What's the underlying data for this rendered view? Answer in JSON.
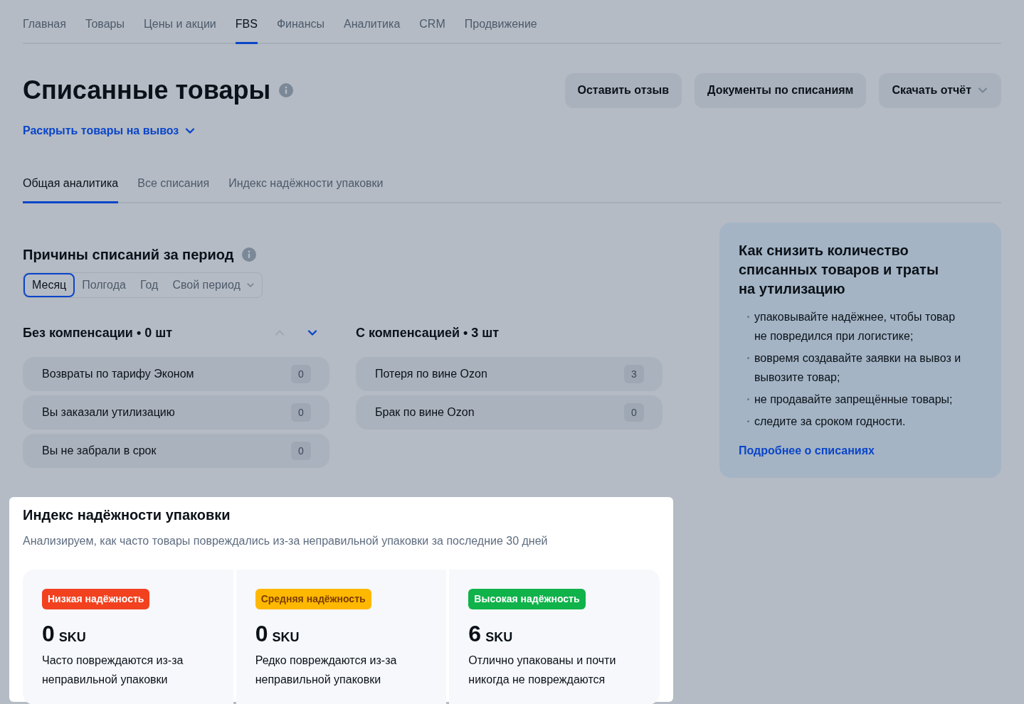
{
  "nav": [
    {
      "label": "Главная",
      "selected": false
    },
    {
      "label": "Товары",
      "selected": false
    },
    {
      "label": "Цены и акции",
      "selected": false
    },
    {
      "label": "FBS",
      "selected": true
    },
    {
      "label": "Финансы",
      "selected": false
    },
    {
      "label": "Аналитика",
      "selected": false
    },
    {
      "label": "CRM",
      "selected": false
    },
    {
      "label": "Продвижение",
      "selected": false
    }
  ],
  "page_title": "Списанные товары",
  "actions": [
    {
      "label": "Оставить отзыв",
      "kind": "plain"
    },
    {
      "label": "Документы по списаниям",
      "kind": "plain"
    },
    {
      "label": "Скачать отчёт",
      "kind": "dropdown"
    }
  ],
  "expand_link": "Раскрыть товары на вывоз",
  "tabs": [
    {
      "label": "Общая аналитика",
      "selected": true
    },
    {
      "label": "Все списания",
      "selected": false
    },
    {
      "label": "Индекс надёжности упаковки",
      "selected": false
    }
  ],
  "reasons": {
    "title": "Причины списаний за период",
    "periods": [
      {
        "label": "Месяц",
        "selected": true,
        "kind": "option"
      },
      {
        "label": "Полгода",
        "selected": false,
        "kind": "option"
      },
      {
        "label": "Год",
        "selected": false,
        "kind": "option"
      },
      {
        "label": "Свой период",
        "selected": false,
        "kind": "dropdown"
      }
    ],
    "groups": [
      {
        "title": "Без компенсации • 0 шт",
        "arrows": [
          {
            "kind": "up",
            "disabled": true
          },
          {
            "kind": "down",
            "disabled": false
          }
        ],
        "items": [
          {
            "label": "Возвраты по тарифу Эконом",
            "count": "0"
          },
          {
            "label": "Вы заказали утилизацию",
            "count": "0"
          },
          {
            "label": "Вы не забрали в срок",
            "count": "0"
          }
        ]
      },
      {
        "title": "С компенсацией • 3 шт",
        "items": [
          {
            "label": "Потеря по вине Ozon",
            "count": "3"
          },
          {
            "label": "Брак по вине Ozon",
            "count": "0"
          }
        ]
      }
    ]
  },
  "tips": {
    "title": "Как снизить количество списанных товаров и траты на утилизацию",
    "items": [
      "упаковывайте надёжнее, чтобы товар не повредился при логистике;",
      "вовремя создавайте заявки на вывоз и вывозите товар;",
      "не продавайте запрещённые товары;",
      "следите за сроком годности."
    ],
    "link": "Подробнее о списаниях"
  },
  "reliability": {
    "title": "Индекс надёжности упаковки",
    "subtitle": "Анализируем, как часто товары повреждались из-за неправильной упаковки за последние 30 дней",
    "levels": [
      {
        "badge": "Низкая надёжность",
        "color": "#f2411f",
        "kind": "low",
        "count": "0",
        "unit": "SKU",
        "description": "Часто повреждаются из-за неправильной упаковки"
      },
      {
        "badge": "Средняя надёжность",
        "color": "#ffb800",
        "kind": "medium",
        "count": "0",
        "unit": "SKU",
        "description": "Редко повреждаются из-за неправильной упаковки"
      },
      {
        "badge": "Высокая надёжность",
        "color": "#10b24a",
        "kind": "high",
        "count": "6",
        "unit": "SKU",
        "description": "Отлично упакованы и почти никогда не повреждаются"
      }
    ]
  }
}
